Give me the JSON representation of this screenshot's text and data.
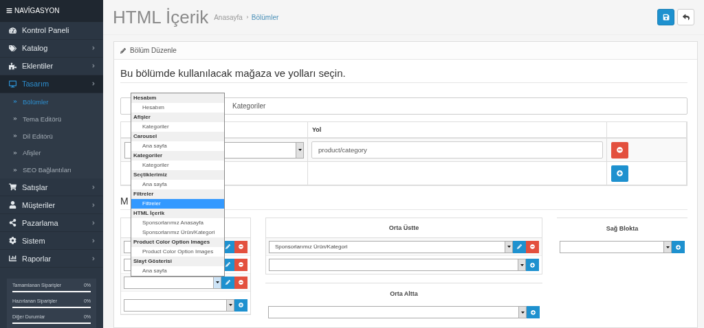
{
  "sidebar": {
    "title": "NAVİGASYON",
    "items": [
      {
        "label": "Kontrol Paneli",
        "expandable": false,
        "selected": false
      },
      {
        "label": "Katalog",
        "expandable": true,
        "selected": false
      },
      {
        "label": "Eklentiler",
        "expandable": true,
        "selected": false
      },
      {
        "label": "Tasarım",
        "expandable": true,
        "selected": true,
        "children": [
          {
            "label": "Bölümler",
            "selected": true
          },
          {
            "label": "Tema Editörü",
            "selected": false
          },
          {
            "label": "Dil Editörü",
            "selected": false
          },
          {
            "label": "Afişler",
            "selected": false
          },
          {
            "label": "SEO Bağlantıları",
            "selected": false
          }
        ]
      },
      {
        "label": "Satışlar",
        "expandable": true,
        "selected": false
      },
      {
        "label": "Müşteriler",
        "expandable": true,
        "selected": false
      },
      {
        "label": "Pazarlama",
        "expandable": true,
        "selected": false
      },
      {
        "label": "Sistem",
        "expandable": true,
        "selected": false
      },
      {
        "label": "Raporlar",
        "expandable": true,
        "selected": false
      }
    ],
    "stats": [
      {
        "label": "Tamamlanan Siparişler",
        "value": "0%",
        "level": 0
      },
      {
        "label": "Hazırlanan Siparişler",
        "value": "0%",
        "level": 0
      },
      {
        "label": "Diğer Durumlar",
        "value": "0%",
        "level": 0
      }
    ]
  },
  "header": {
    "title": "HTML İçerik",
    "breadcrumb": [
      {
        "label": "Anasayfa",
        "selected": false
      },
      {
        "label": "Bölümler",
        "selected": true
      }
    ]
  },
  "panel": {
    "title": "Bölüm Düzenle",
    "intro": "Bu bölümde kullanılacak mağaza ve yolları seçin.",
    "name_value": "Kategoriler",
    "route_table": {
      "columns": [
        "Yol"
      ],
      "rows": [
        {
          "route": "product/category"
        }
      ]
    },
    "modules_heading": "M",
    "column_left": {
      "modules": [
        {
          "focused": false
        },
        {
          "focused": false
        },
        {
          "focused": true
        }
      ]
    },
    "content_top": {
      "title": "Orta Üstte",
      "modules": [
        {
          "value": "Sponsorlarımız Ürün/Kategori",
          "focused": false
        }
      ]
    },
    "content_bottom": {
      "title": "Orta Altta"
    },
    "column_right": {
      "title": "Sağ Blokta"
    }
  },
  "dropdown": {
    "groups": [
      {
        "label": "Hesabım",
        "options": [
          {
            "label": "Hesabım",
            "selected": false
          }
        ]
      },
      {
        "label": "Afişler",
        "options": [
          {
            "label": "Kategoriler",
            "selected": false
          }
        ]
      },
      {
        "label": "Carousel",
        "options": [
          {
            "label": "Ana sayfa",
            "selected": false
          }
        ]
      },
      {
        "label": "Kategoriler",
        "options": [
          {
            "label": "Kategoriler",
            "selected": false
          }
        ]
      },
      {
        "label": "Seçtiklerimiz",
        "options": [
          {
            "label": "Ana sayfa",
            "selected": false
          }
        ]
      },
      {
        "label": "Filtreler",
        "options": [
          {
            "label": "Filtreler",
            "selected": true
          }
        ]
      },
      {
        "label": "HTML İçerik",
        "options": [
          {
            "label": "Sponsorlarımız Anasayfa",
            "selected": false
          },
          {
            "label": "Sponsorlarımız Ürün/Kategori",
            "selected": false
          }
        ]
      },
      {
        "label": "Product Color Option Images",
        "options": [
          {
            "label": "Product Color Option Images",
            "selected": false
          }
        ]
      },
      {
        "label": "Slayt Gösterisi",
        "options": [
          {
            "label": "Ana sayfa",
            "selected": false
          }
        ]
      }
    ]
  }
}
